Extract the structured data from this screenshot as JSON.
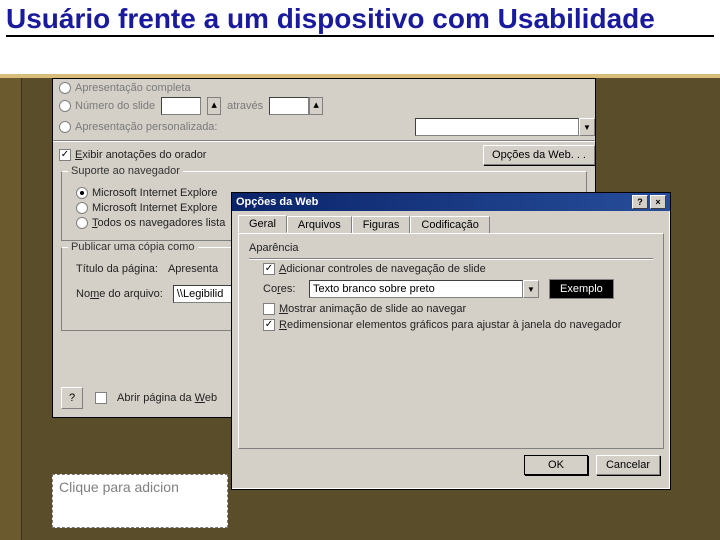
{
  "slide": {
    "title": "Usuário frente a um dispositivo com Usabilidade",
    "notes_placeholder": "Clique para adicion"
  },
  "publish": {
    "radio_complete": "Apresentação completa",
    "radio_slide_num": "Número do slide",
    "through": "através",
    "radio_custom": "Apresentação personalizada:",
    "chk_speaker_notes": "Exibir anotações do orador",
    "btn_weboptions": "Opções da Web. . .",
    "group_browser": "Suporte ao navegador",
    "browser_ie": "Microsoft Internet Explore",
    "browser_ie2": "Microsoft Internet Explore",
    "browser_all": "Todos os navegadores lista",
    "group_copy": "Publicar uma cópia como",
    "page_title_lbl": "Título da página:",
    "page_title_val": "Apresenta",
    "file_name_lbl": "Nome do arquivo:",
    "file_name_val": "\\\\Legibilid",
    "open_in_browser": "Abrir página da Web"
  },
  "webopt": {
    "title": "Opções da Web",
    "tabs": {
      "general": "Geral",
      "files": "Arquivos",
      "figures": "Figuras",
      "encoding": "Codificação"
    },
    "section_appearance": "Aparência",
    "chk_add_nav": "Adicionar controles de navegação de slide",
    "colors_lbl": "Cores:",
    "colors_val": "Texto branco sobre preto",
    "btn_example": "Exemplo",
    "chk_show_anim": "Mostrar animação de slide ao navegar",
    "chk_resize_gfx": "Redimensionar elementos gráficos para ajustar à janela do navegador",
    "btn_ok": "OK",
    "btn_cancel": "Cancelar"
  }
}
